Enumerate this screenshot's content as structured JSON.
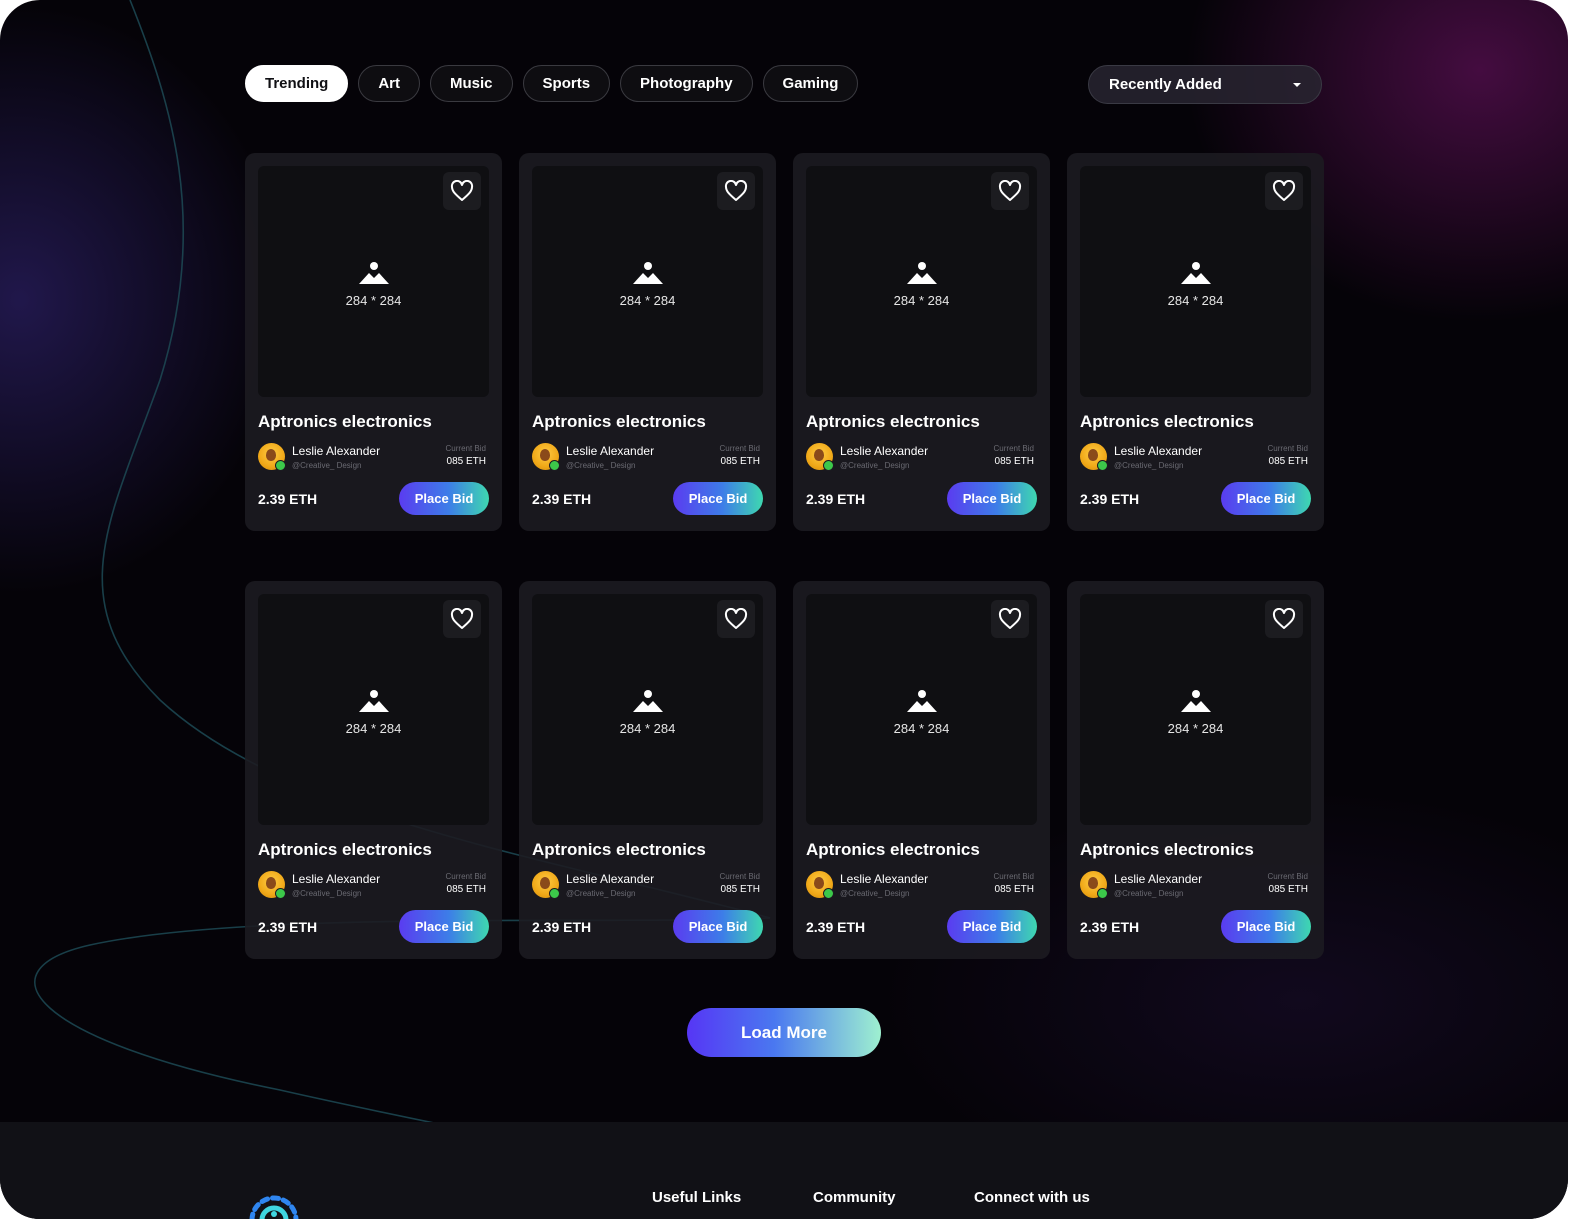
{
  "filters": {
    "tabs": [
      "Trending",
      "Art",
      "Music",
      "Sports",
      "Photography",
      "Gaming"
    ],
    "active": "Trending"
  },
  "sort": {
    "selected": "Recently Added"
  },
  "cards": [
    {
      "title": "Aptronics electronics",
      "placeholder": "284 * 284",
      "creator": "Leslie Alexander",
      "handle": "@Creative_ Design",
      "bid_label": "Current Bid",
      "current_bid": "085 ETH",
      "price": "2.39 ETH",
      "action": "Place Bid"
    },
    {
      "title": "Aptronics electronics",
      "placeholder": "284 * 284",
      "creator": "Leslie Alexander",
      "handle": "@Creative_ Design",
      "bid_label": "Current Bid",
      "current_bid": "085 ETH",
      "price": "2.39 ETH",
      "action": "Place Bid"
    },
    {
      "title": "Aptronics electronics",
      "placeholder": "284 * 284",
      "creator": "Leslie Alexander",
      "handle": "@Creative_ Design",
      "bid_label": "Current Bid",
      "current_bid": "085 ETH",
      "price": "2.39 ETH",
      "action": "Place Bid"
    },
    {
      "title": "Aptronics electronics",
      "placeholder": "284 * 284",
      "creator": "Leslie Alexander",
      "handle": "@Creative_ Design",
      "bid_label": "Current Bid",
      "current_bid": "085 ETH",
      "price": "2.39 ETH",
      "action": "Place Bid"
    },
    {
      "title": "Aptronics electronics",
      "placeholder": "284 * 284",
      "creator": "Leslie Alexander",
      "handle": "@Creative_ Design",
      "bid_label": "Current Bid",
      "current_bid": "085 ETH",
      "price": "2.39 ETH",
      "action": "Place Bid"
    },
    {
      "title": "Aptronics electronics",
      "placeholder": "284 * 284",
      "creator": "Leslie Alexander",
      "handle": "@Creative_ Design",
      "bid_label": "Current Bid",
      "current_bid": "085 ETH",
      "price": "2.39 ETH",
      "action": "Place Bid"
    },
    {
      "title": "Aptronics electronics",
      "placeholder": "284 * 284",
      "creator": "Leslie Alexander",
      "handle": "@Creative_ Design",
      "bid_label": "Current Bid",
      "current_bid": "085 ETH",
      "price": "2.39 ETH",
      "action": "Place Bid"
    },
    {
      "title": "Aptronics electronics",
      "placeholder": "284 * 284",
      "creator": "Leslie Alexander",
      "handle": "@Creative_ Design",
      "bid_label": "Current Bid",
      "current_bid": "085 ETH",
      "price": "2.39 ETH",
      "action": "Place Bid"
    }
  ],
  "load_more": "Load More",
  "footer": {
    "columns": [
      "Useful Links",
      "Community",
      "Connect with us"
    ]
  },
  "colors": {
    "background": "#050308",
    "card": "#1c1b21",
    "accent_start": "#5a3cf0",
    "accent_end": "#3ed8b0"
  },
  "icons": {
    "favorite": "heart-icon",
    "media_placeholder": "image-icon",
    "dropdown": "caret-down-icon"
  }
}
